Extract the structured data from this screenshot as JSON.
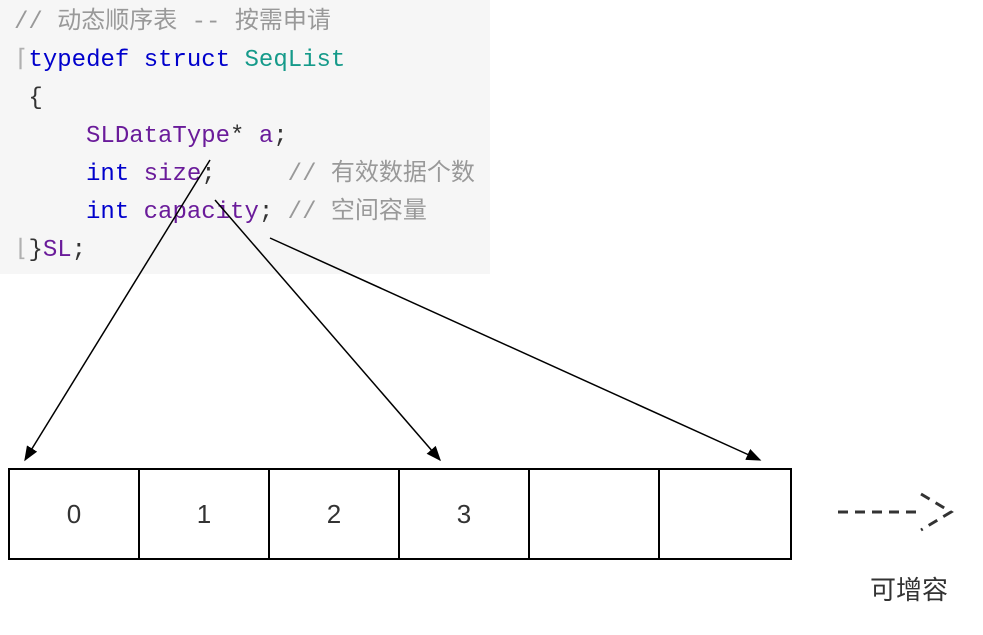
{
  "code": {
    "comment_top_a": "// ",
    "comment_top_b": "动态顺序表 -- 按需申请",
    "kw_typedef": "typedef",
    "kw_struct": "struct",
    "struct_name": "SeqList",
    "brace_open": "{",
    "type_ptr": "SLDataType",
    "star": "*",
    "field_a": "a",
    "kw_int1": "int",
    "field_size": "size",
    "comment_size_a": "// ",
    "comment_size_b": "有效数据个数",
    "kw_int2": "int",
    "field_cap": "capacity",
    "comment_cap_a": "// ",
    "comment_cap_b": "空间容量",
    "brace_close": "}",
    "alias": "SL",
    "semi": ";"
  },
  "array": {
    "cells": [
      "0",
      "1",
      "2",
      "3",
      "",
      ""
    ]
  },
  "labels": {
    "expand": "可增容"
  }
}
